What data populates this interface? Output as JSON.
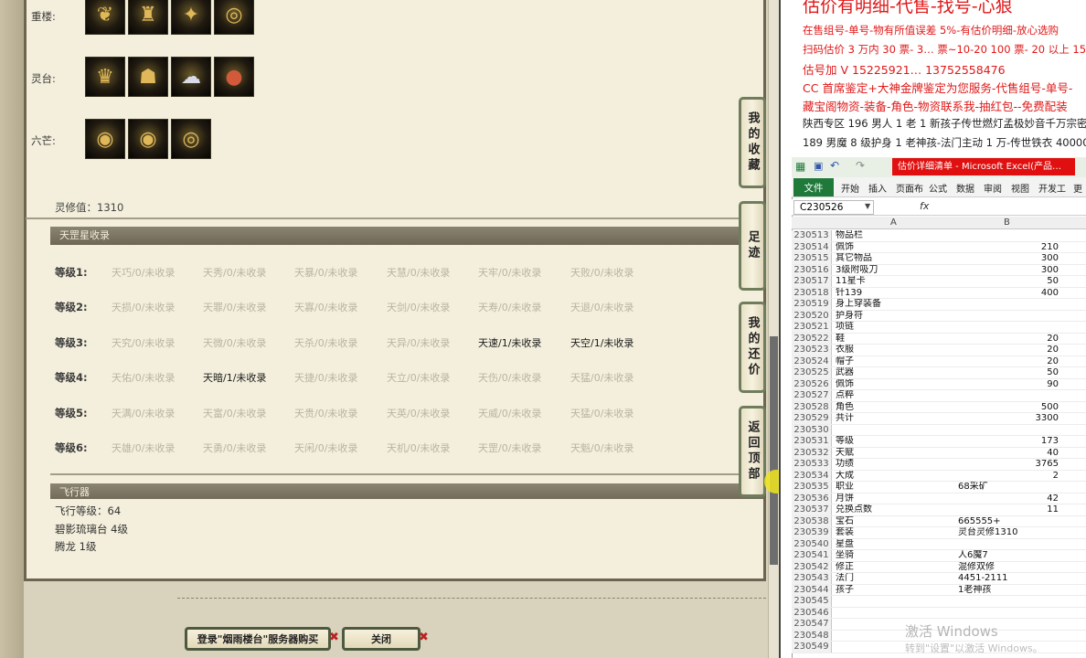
{
  "game": {
    "slots": [
      {
        "label": "重楼:",
        "icons": [
          "necklace-icon",
          "shoulder-armor-icon",
          "pendant-icon",
          "bracelet-icon"
        ]
      },
      {
        "label": "灵台:",
        "icons": [
          "crown-icon",
          "mask-icon",
          "spirit-icon",
          "orb-icon"
        ]
      },
      {
        "label": "六芒:",
        "icons": [
          "ring-icon",
          "ring-icon",
          "bracelet-icon"
        ]
      }
    ],
    "lingxiu": "灵修值：1310",
    "tiangang_header": "天罡星收录",
    "levels": [
      {
        "label": "等级1:",
        "cells": [
          {
            "t": "天巧/0/未收录",
            "on": false
          },
          {
            "t": "天秀/0/未收录",
            "on": false
          },
          {
            "t": "天暴/0/未收录",
            "on": false
          },
          {
            "t": "天慧/0/未收录",
            "on": false
          },
          {
            "t": "天牢/0/未收录",
            "on": false
          },
          {
            "t": "天败/0/未收录",
            "on": false
          }
        ]
      },
      {
        "label": "等级2:",
        "cells": [
          {
            "t": "天损/0/未收录",
            "on": false
          },
          {
            "t": "天罪/0/未收录",
            "on": false
          },
          {
            "t": "天寡/0/未收录",
            "on": false
          },
          {
            "t": "天剑/0/未收录",
            "on": false
          },
          {
            "t": "天寿/0/未收录",
            "on": false
          },
          {
            "t": "天退/0/未收录",
            "on": false
          }
        ]
      },
      {
        "label": "等级3:",
        "cells": [
          {
            "t": "天究/0/未收录",
            "on": false
          },
          {
            "t": "天微/0/未收录",
            "on": false
          },
          {
            "t": "天杀/0/未收录",
            "on": false
          },
          {
            "t": "天异/0/未收录",
            "on": false
          },
          {
            "t": "天速/1/未收录",
            "on": true
          },
          {
            "t": "天空/1/未收录",
            "on": true
          }
        ]
      },
      {
        "label": "等级4:",
        "cells": [
          {
            "t": "天佑/0/未收录",
            "on": false
          },
          {
            "t": "天暗/1/未收录",
            "on": true
          },
          {
            "t": "天捷/0/未收录",
            "on": false
          },
          {
            "t": "天立/0/未收录",
            "on": false
          },
          {
            "t": "天伤/0/未收录",
            "on": false
          },
          {
            "t": "天猛/0/未收录",
            "on": false
          }
        ]
      },
      {
        "label": "等级5:",
        "cells": [
          {
            "t": "天满/0/未收录",
            "on": false
          },
          {
            "t": "天富/0/未收录",
            "on": false
          },
          {
            "t": "天贵/0/未收录",
            "on": false
          },
          {
            "t": "天英/0/未收录",
            "on": false
          },
          {
            "t": "天威/0/未收录",
            "on": false
          },
          {
            "t": "天猛/0/未收录",
            "on": false
          }
        ]
      },
      {
        "label": "等级6:",
        "cells": [
          {
            "t": "天雄/0/未收录",
            "on": false
          },
          {
            "t": "天勇/0/未收录",
            "on": false
          },
          {
            "t": "天闲/0/未收录",
            "on": false
          },
          {
            "t": "天机/0/未收录",
            "on": false
          },
          {
            "t": "天罡/0/未收录",
            "on": false
          },
          {
            "t": "天魁/0/未收录",
            "on": false
          }
        ]
      }
    ],
    "fly_header": "飞行器",
    "fly_lines": [
      "飞行等级：64",
      "碧影琉璃台   4级",
      "腾龙   1级"
    ],
    "buttons": {
      "login": "登录\"烟雨楼台\"服务器购买",
      "close": "关闭"
    },
    "side_tabs": [
      "我的收藏",
      "足迹",
      "我的还价",
      "返回顶部"
    ]
  },
  "ad": {
    "title": "估价有明细-代售-找号-心狠",
    "lines": [
      {
        "t": "在售组号-单号-物有所值误差 5%-有估价明细-放心选购",
        "c": "#e01818"
      },
      {
        "t": "扫码估价 3 万内 30 票- 3…    票~10-20 100 票- 20 以上 150+",
        "c": "#e01818"
      },
      {
        "t": "估号加 V 15225921… 13752558476",
        "c": "#e01818"
      },
      {
        "t": "CC 首席鉴定+大神金牌鉴定为您服务-代售组号-单号-",
        "c": "#e01818"
      },
      {
        "t": "藏宝阁物资-装备-角色-物资联系我-抽红包--免费配装",
        "c": "#e01818"
      },
      {
        "t": "陕西专区 196 男人 1 老 1 新孩子传世燃灯孟极妙音千万宗密 4",
        "c": "#222"
      },
      {
        "t": "189 男魔 8 级护身 1 老神孩-法门主动 1 万-传世铁衣 40000",
        "c": "#222"
      }
    ]
  },
  "excel": {
    "title": "估价详细清单 - Microsoft Excel(产品…",
    "file_tab": "文件",
    "tabs": [
      "开始",
      "插入",
      "页面布",
      "公式",
      "数据",
      "审阅",
      "视图",
      "开发工",
      "更"
    ],
    "namebox": "C230526",
    "fx": "fx",
    "col_a": "A",
    "col_b": "B",
    "rows": [
      {
        "n": "230513",
        "a": "物品栏",
        "b": "",
        "num": false
      },
      {
        "n": "230514",
        "a": "佩饰",
        "b": "210",
        "num": true
      },
      {
        "n": "230515",
        "a": "其它物品",
        "b": "300",
        "num": true
      },
      {
        "n": "230516",
        "a": "3级附吸刀",
        "b": "300",
        "num": true
      },
      {
        "n": "230517",
        "a": "11星卡",
        "b": "50",
        "num": true
      },
      {
        "n": "230518",
        "a": "针139",
        "b": "400",
        "num": true
      },
      {
        "n": "230519",
        "a": "身上穿装备",
        "b": "",
        "num": false
      },
      {
        "n": "230520",
        "a": "护身符",
        "b": "",
        "num": false
      },
      {
        "n": "230521",
        "a": "项链",
        "b": "",
        "num": false
      },
      {
        "n": "230522",
        "a": "鞋",
        "b": "20",
        "num": true
      },
      {
        "n": "230523",
        "a": "衣服",
        "b": "20",
        "num": true
      },
      {
        "n": "230524",
        "a": "帽子",
        "b": "20",
        "num": true
      },
      {
        "n": "230525",
        "a": "武器",
        "b": "50",
        "num": true
      },
      {
        "n": "230526",
        "a": "佩饰",
        "b": "90",
        "num": true
      },
      {
        "n": "230527",
        "a": "点粹",
        "b": "",
        "num": false
      },
      {
        "n": "230528",
        "a": "角色",
        "b": "500",
        "num": true
      },
      {
        "n": "230529",
        "a": "共计",
        "b": "3300",
        "num": true
      },
      {
        "n": "230530",
        "a": "",
        "b": "",
        "num": false
      },
      {
        "n": "230531",
        "a": "等级",
        "b": "173",
        "num": true
      },
      {
        "n": "230532",
        "a": "天赋",
        "b": "40",
        "num": true
      },
      {
        "n": "230533",
        "a": "功绩",
        "b": "3765",
        "num": true
      },
      {
        "n": "230534",
        "a": "大成",
        "b": "2",
        "num": true
      },
      {
        "n": "230535",
        "a": "职业",
        "b": "68采矿",
        "num": false
      },
      {
        "n": "230536",
        "a": "月饼",
        "b": "42",
        "num": true
      },
      {
        "n": "230537",
        "a": "兑换点数",
        "b": "11",
        "num": true
      },
      {
        "n": "230538",
        "a": "宝石",
        "b": "665555+",
        "num": false
      },
      {
        "n": "230539",
        "a": "套装",
        "b": "灵台灵修1310",
        "num": false
      },
      {
        "n": "230540",
        "a": "星盘",
        "b": "",
        "num": false
      },
      {
        "n": "230541",
        "a": "坐骑",
        "b": "人6魔7",
        "num": false
      },
      {
        "n": "230542",
        "a": "修正",
        "b": "混修双修",
        "num": false
      },
      {
        "n": "230543",
        "a": "法门",
        "b": "4451-2111",
        "num": false
      },
      {
        "n": "230544",
        "a": "孩子",
        "b": "1老神孩",
        "num": false
      },
      {
        "n": "230545",
        "a": "",
        "b": "",
        "num": false
      },
      {
        "n": "230546",
        "a": "",
        "b": "",
        "num": false
      },
      {
        "n": "230547",
        "a": "",
        "b": "",
        "num": false
      },
      {
        "n": "230548",
        "a": "",
        "b": "",
        "num": false
      },
      {
        "n": "230549",
        "a": "",
        "b": "",
        "num": false
      }
    ],
    "watermark": "激活 Windows",
    "watermark_sub": "转到\"设置\"以激活 Windows。"
  }
}
